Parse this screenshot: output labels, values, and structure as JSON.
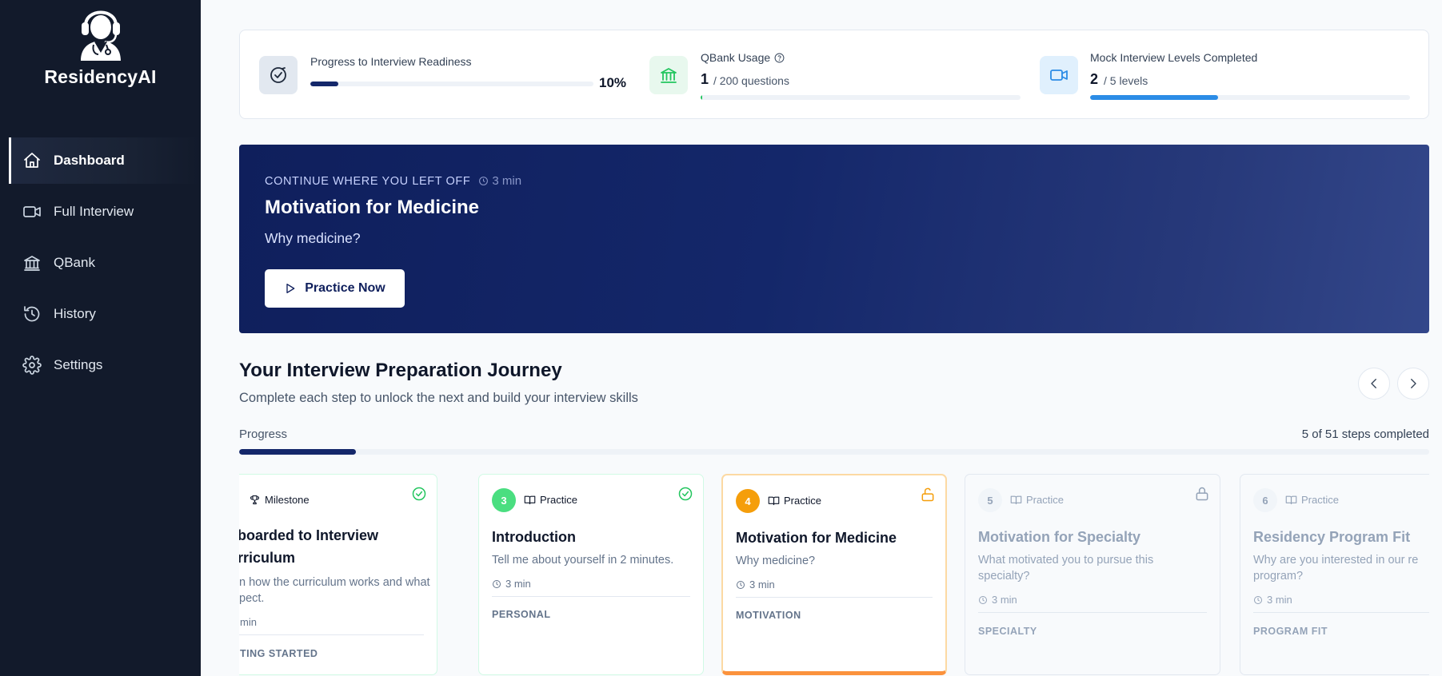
{
  "app": {
    "brand": "ResidencyAI"
  },
  "sidebar": {
    "items": [
      {
        "label": "Dashboard",
        "icon": "home-icon",
        "active": true
      },
      {
        "label": "Full Interview",
        "icon": "video-icon",
        "active": false
      },
      {
        "label": "QBank",
        "icon": "bank-icon",
        "active": false
      },
      {
        "label": "History",
        "icon": "history-icon",
        "active": false
      },
      {
        "label": "Settings",
        "icon": "gear-icon",
        "active": false
      }
    ]
  },
  "stats": {
    "readiness": {
      "label": "Progress to Interview Readiness",
      "percent_text": "10%",
      "fraction": 0.1
    },
    "qbank": {
      "label": "QBank Usage",
      "value": "1",
      "suffix": "/ 200 questions",
      "fraction": 0.005
    },
    "mock": {
      "label": "Mock Interview Levels Completed",
      "value": "2",
      "suffix": "/ 5 levels",
      "fraction": 0.4
    }
  },
  "hero": {
    "kicker": "CONTINUE WHERE YOU LEFT OFF",
    "time": "3 min",
    "title": "Motivation for Medicine",
    "subtitle": "Why medicine?",
    "button": "Practice Now"
  },
  "journey": {
    "title": "Your Interview Preparation Journey",
    "subtitle": "Complete each step to unlock the next and build your interview skills",
    "progress_label": "Progress",
    "progress_count": "5 of 51 steps completed",
    "fraction": 0.098
  },
  "cards": [
    {
      "step": "",
      "type": "Milestone",
      "status": "completed",
      "title": "boarded to Interview rriculum",
      "desc": "n how the curriculum works and what pect.",
      "time": "min",
      "category": "TING STARTED"
    },
    {
      "step": "3",
      "type": "Practice",
      "status": "completed",
      "title": "Introduction",
      "desc": "Tell me about yourself in 2 minutes.",
      "time": "3 min",
      "category": "PERSONAL"
    },
    {
      "step": "4",
      "type": "Practice",
      "status": "current",
      "title": "Motivation for Medicine",
      "desc": "Why medicine?",
      "time": "3 min",
      "category": "MOTIVATION"
    },
    {
      "step": "5",
      "type": "Practice",
      "status": "locked",
      "title": "Motivation for Specialty",
      "desc": "What motivated you to pursue this specialty?",
      "time": "3 min",
      "category": "SPECIALTY"
    },
    {
      "step": "6",
      "type": "Practice",
      "status": "locked",
      "title": "Residency Program Fit",
      "desc": "Why are you interested in our re program?",
      "time": "3 min",
      "category": "PROGRAM FIT"
    }
  ],
  "colors": {
    "sidebar": "#121a2b",
    "navy": "#14276a",
    "green": "#4ade80",
    "orange": "#f59e0b",
    "blue": "#2b8ce6"
  }
}
